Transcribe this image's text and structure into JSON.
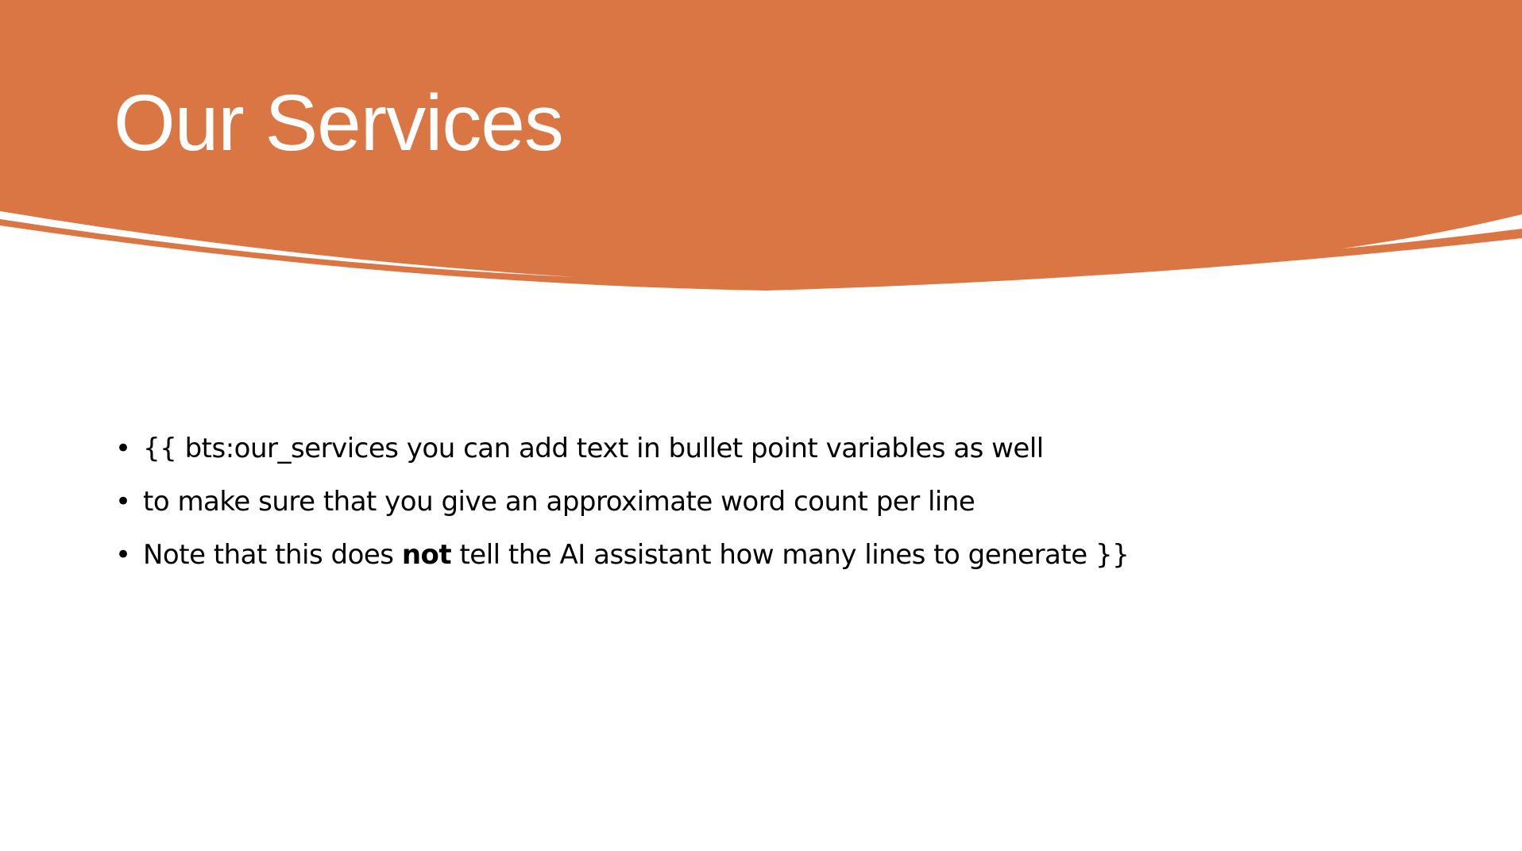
{
  "slide": {
    "title": "Our Services",
    "accent_color": "#DA7643",
    "bullets": [
      {
        "text": "{{ bts:our_services  you can add text in bullet point variables as well"
      },
      {
        "text": "to make sure that you give an approximate word count per line"
      },
      {
        "before": "Note that this does ",
        "bold": "not",
        "after": " tell the AI assistant how many lines to generate }}"
      }
    ]
  }
}
